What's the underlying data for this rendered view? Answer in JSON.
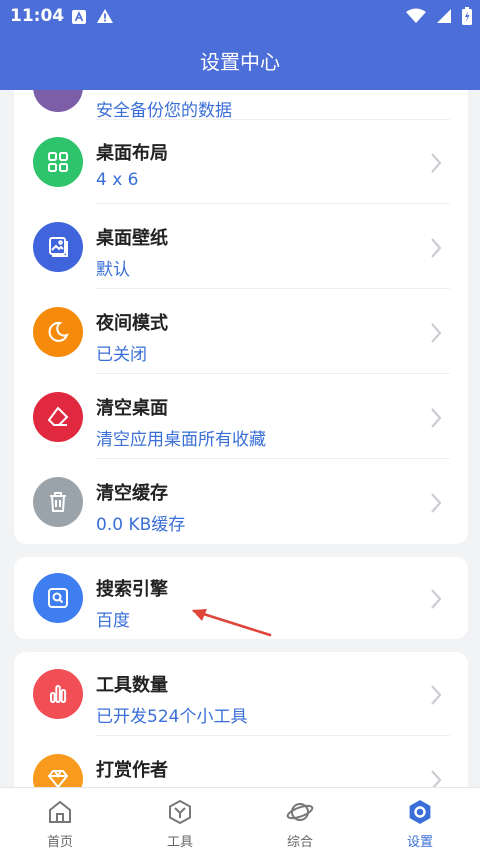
{
  "status_bar": {
    "time": "11:04"
  },
  "header": {
    "title": "设置中心"
  },
  "settings": {
    "card1_rows": [
      {
        "title": "",
        "subtitle": "安全备份您的数据",
        "color": "#7b5ea7",
        "icon": "backup-icon"
      },
      {
        "title": "桌面布局",
        "subtitle": "4 x 6",
        "color": "#2ec46b",
        "icon": "grid-icon"
      },
      {
        "title": "桌面壁纸",
        "subtitle": "默认",
        "color": "#3f64db",
        "icon": "image-icon"
      },
      {
        "title": "夜间模式",
        "subtitle": "已关闭",
        "color": "#f58a0b",
        "icon": "moon-icon"
      },
      {
        "title": "清空桌面",
        "subtitle": "清空应用桌面所有收藏",
        "color": "#e0283f",
        "icon": "eraser-icon"
      },
      {
        "title": "清空缓存",
        "subtitle": "0.0 KB缓存",
        "color": "#9aa3aa",
        "icon": "trash-icon"
      }
    ],
    "search_engine": {
      "title": "搜索引擎",
      "subtitle": "百度",
      "color": "#3f7ef0",
      "icon": "search-box-icon"
    },
    "card3_rows": [
      {
        "title": "工具数量",
        "subtitle": "已开发524个小工具",
        "color": "#f24e55",
        "icon": "bar-chart-icon"
      },
      {
        "title": "打赏作者",
        "subtitle": "",
        "color": "#f79a1e",
        "icon": "diamond-icon"
      }
    ]
  },
  "bottom_nav": {
    "items": [
      {
        "label": "首页",
        "icon": "home-icon"
      },
      {
        "label": "工具",
        "icon": "tools-icon"
      },
      {
        "label": "综合",
        "icon": "planet-icon"
      },
      {
        "label": "设置",
        "icon": "settings-icon"
      }
    ],
    "active_color": "#3a6fd8"
  }
}
